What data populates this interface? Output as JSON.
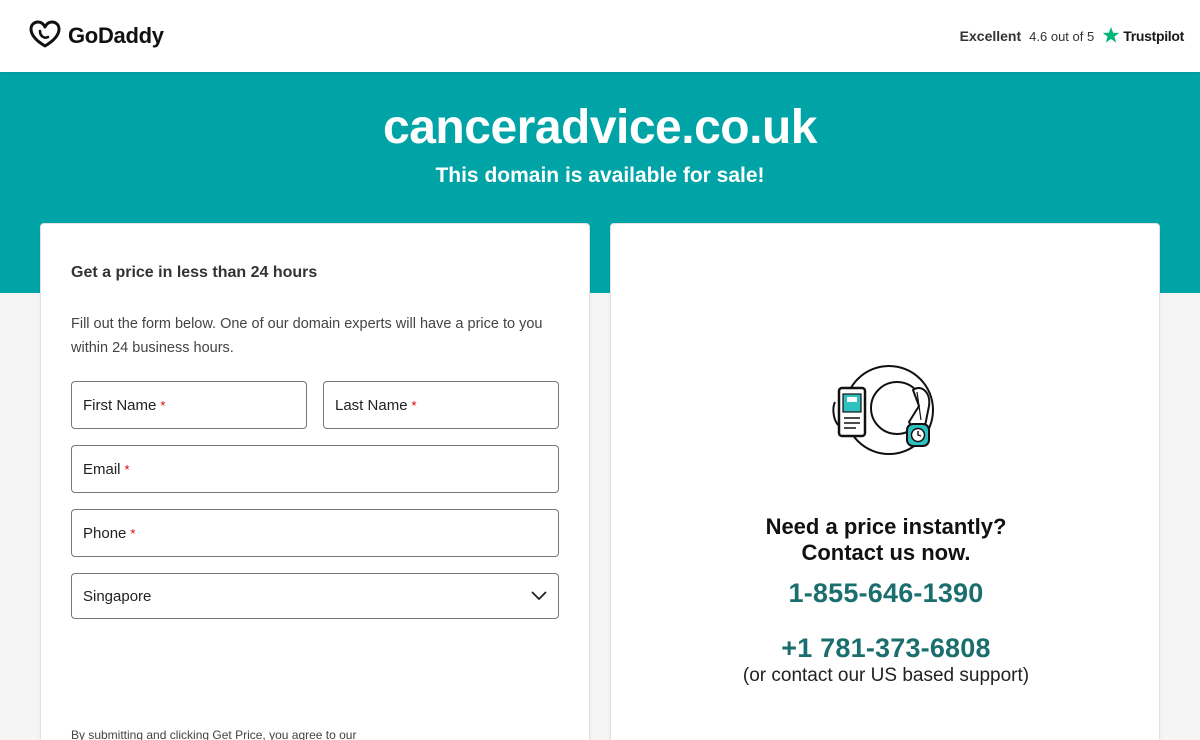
{
  "header": {
    "brand_name": "GoDaddy",
    "logo_icon": "godaddy-logo-icon",
    "trust": {
      "rating_word": "Excellent",
      "score_text": "4.6 out of 5",
      "provider": "Trustpilot",
      "star_icon": "trustpilot-star-icon"
    }
  },
  "hero": {
    "domain": "canceradvice.co.uk",
    "tagline": "This domain is available for sale!",
    "background_color": "#00a4a6"
  },
  "form": {
    "title": "Get a price in less than 24 hours",
    "description": "Fill out the form below. One of our domain experts will have a price to you within 24 business hours.",
    "fields": {
      "first_name": {
        "label": "First Name",
        "required_mark": "*"
      },
      "last_name": {
        "label": "Last Name",
        "required_mark": "*"
      },
      "email": {
        "label": "Email",
        "required_mark": "*"
      },
      "phone": {
        "label": "Phone",
        "required_mark": "*"
      },
      "country": {
        "selected": "Singapore"
      }
    },
    "legal_text": "By submitting and clicking Get Price, you agree to our"
  },
  "contact": {
    "illustration_icon": "phone-and-clock-icon",
    "heading_line1": "Need a price instantly?",
    "heading_line2": "Contact us now.",
    "phone_primary": "1-855-646-1390",
    "phone_secondary": "+1 781-373-6808",
    "support_note": "(or contact our US based support)",
    "phone_color": "#1b6e6e"
  }
}
